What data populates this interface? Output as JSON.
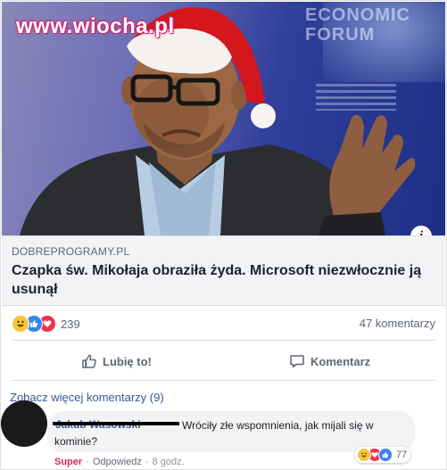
{
  "hero": {
    "watermark": "www.wiocha.pl",
    "event_logo": "ECONOMIC FORUM",
    "info_icon": "i"
  },
  "link_preview": {
    "domain": "DOBREPROGRAMY.PL",
    "title": "Czapka św. Mikołaja obraziła żyda. Microsoft niezwłocznie ją usunął"
  },
  "stats": {
    "reaction_icons": [
      "haha-icon",
      "like-icon",
      "love-icon"
    ],
    "reaction_count": "239",
    "comment_count": "47 komentarzy"
  },
  "actions": {
    "like_label": "Lubię to!",
    "comment_label": "Komentarz"
  },
  "comments": {
    "see_more": "Zobacz więcej komentarzy (9)",
    "items": [
      {
        "author": "Jakub Wasowski",
        "text": "Wróciły złe wspomnienia, jak mijali się w kominie?",
        "reaction_count": "77",
        "reaction_label": "Super",
        "reply_label": "Odpowiedz",
        "time": "8 godz."
      }
    ]
  },
  "colors": {
    "link": "#385898",
    "muted": "#606770",
    "super": "#e0245e",
    "meta_bg": "#f2f3f5"
  }
}
